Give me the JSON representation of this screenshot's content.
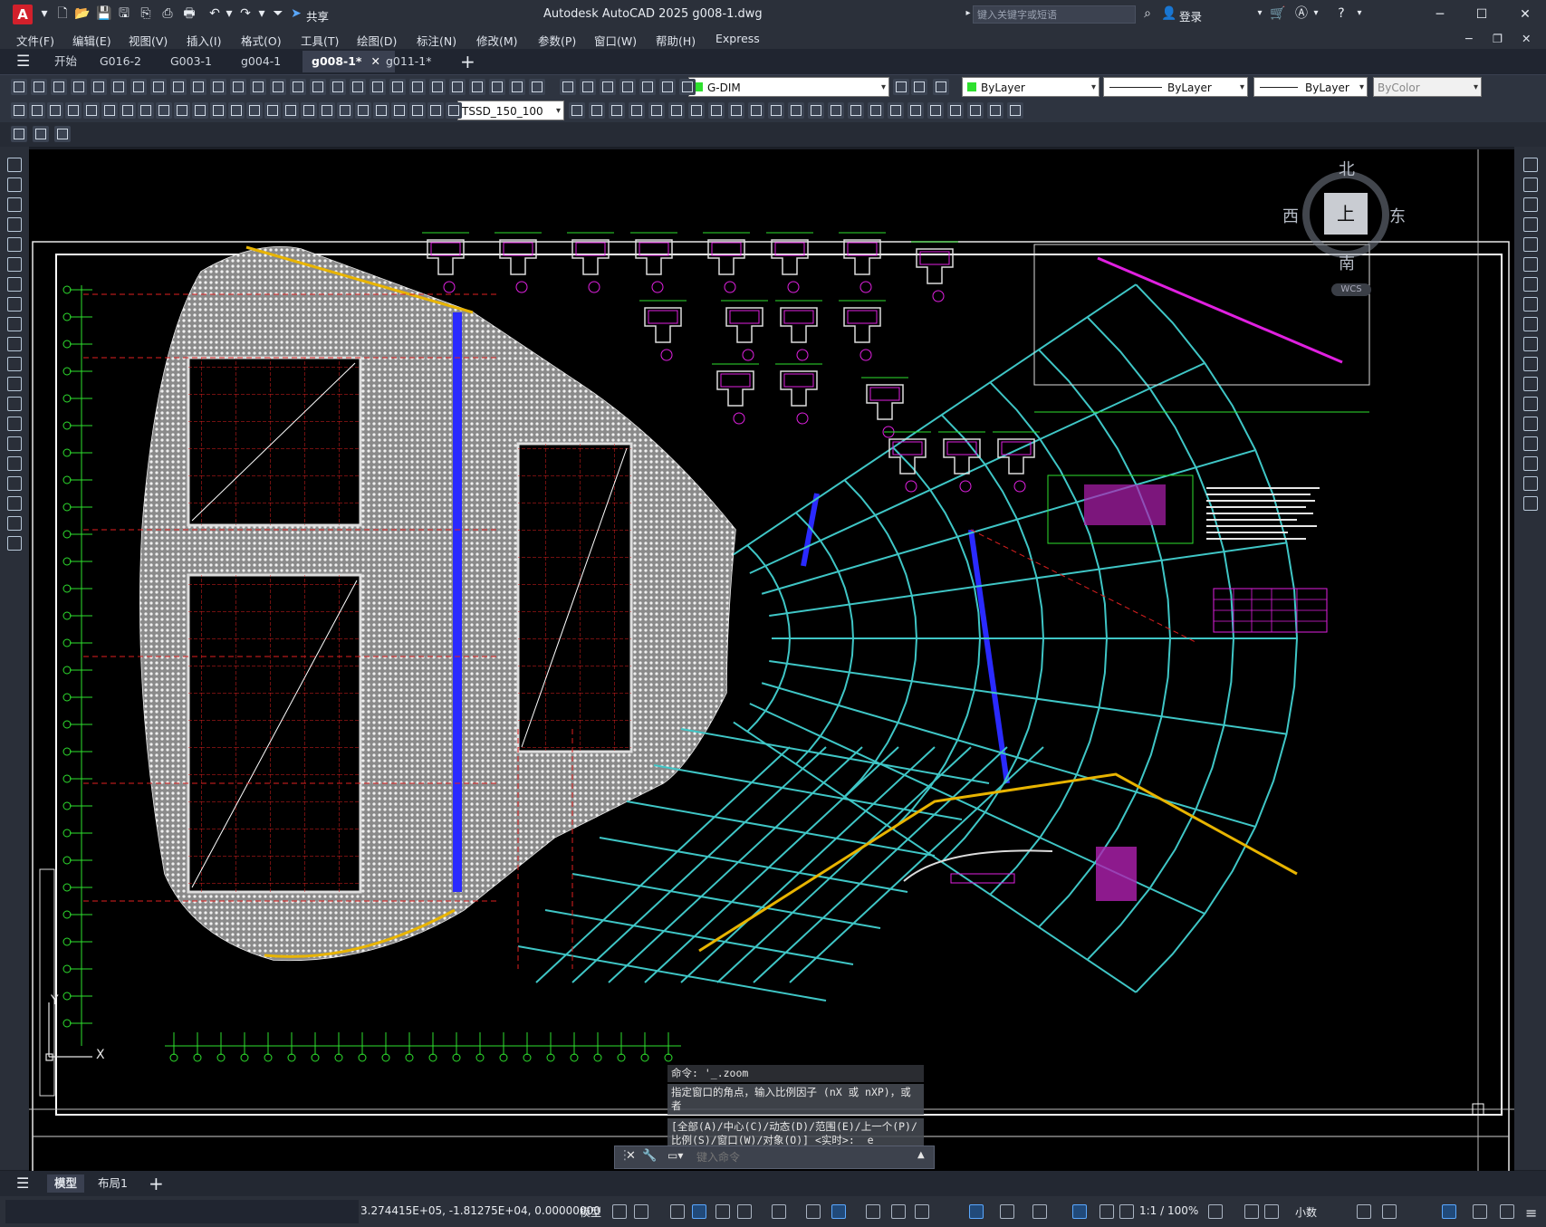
{
  "app": {
    "title": "Autodesk AutoCAD 2025    g008-1.dwg",
    "logo_letter": "A",
    "share_label": "共享",
    "search_placeholder": "键入关键字或短语",
    "login_label": "登录"
  },
  "menu": [
    "文件(F)",
    "编辑(E)",
    "视图(V)",
    "插入(I)",
    "格式(O)",
    "工具(T)",
    "绘图(D)",
    "标注(N)",
    "修改(M)",
    "参数(P)",
    "窗口(W)",
    "帮助(H)",
    "Express"
  ],
  "tabs": [
    {
      "label": "开始",
      "active": false
    },
    {
      "label": "G016-2",
      "active": false
    },
    {
      "label": "G003-1",
      "active": false
    },
    {
      "label": "g004-1",
      "active": false
    },
    {
      "label": "g008-1*",
      "active": true
    },
    {
      "label": "g011-1*",
      "active": false
    }
  ],
  "properties": {
    "layer": "G-DIM",
    "color": "ByLayer",
    "linetype": "ByLayer",
    "lineweight": "ByLayer",
    "plotstyle": "ByColor",
    "dimstyle": "TSSD_150_100"
  },
  "viewcube": {
    "north": "北",
    "south": "南",
    "east": "东",
    "west": "西",
    "top": "上",
    "wcs": "WCS"
  },
  "ucs": {
    "x": "X",
    "y": "Y"
  },
  "command": {
    "history": [
      "命令: '_.zoom",
      "指定窗口的角点，输入比例因子 (nX 或 nXP)，或者",
      "[全部(A)/中心(C)/动态(D)/范围(E)/上一个(P)/比例(S)/窗口(W)/对象(O)] <实时>: _e"
    ],
    "input_placeholder": "键入命令"
  },
  "layout_tabs": [
    {
      "label": "模型",
      "active": true
    },
    {
      "label": "布局1",
      "active": false
    }
  ],
  "status": {
    "coords": "3.274415E+05, -1.81275E+04, 0.00000000",
    "model": "模型",
    "scale": "1:1 / 100%",
    "units": "小数"
  },
  "colors": {
    "canvas": "#000000",
    "accent": "#d2202b",
    "cyan": "#3fc6c6",
    "green": "#2ee02e",
    "magenta": "#e020e0",
    "red": "#e02020",
    "blue": "#2a2aff",
    "yellow": "#e8b400"
  }
}
